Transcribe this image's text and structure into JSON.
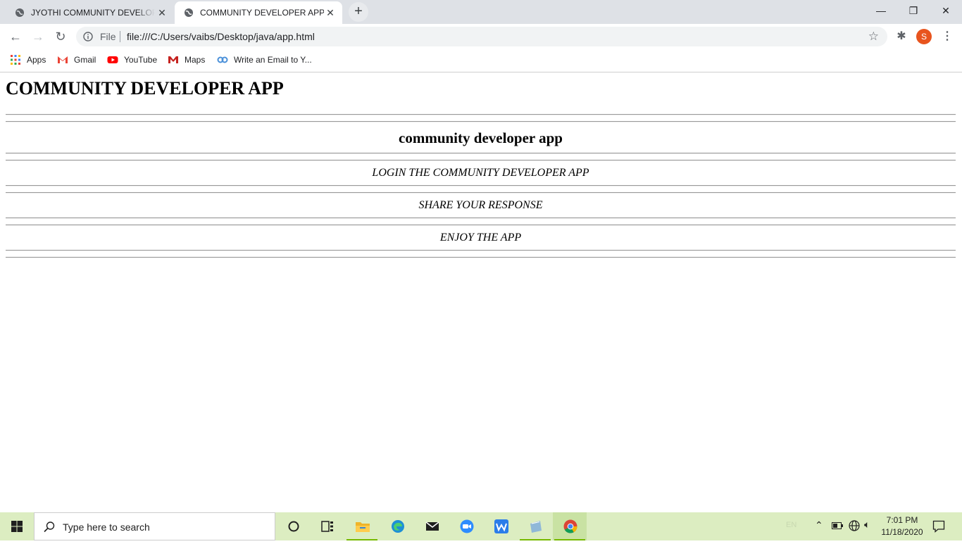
{
  "browser": {
    "tabs": [
      {
        "title": "JYOTHI COMMUNITY DEVELOPER",
        "active": false
      },
      {
        "title": "COMMUNITY DEVELOPER APP",
        "active": true
      }
    ],
    "address": {
      "scheme_label": "File",
      "url": "file:///C:/Users/vaibs/Desktop/java/app.html"
    },
    "profile_initial": "S",
    "bookmarks": [
      {
        "label": "Apps",
        "icon": "apps-grid-icon"
      },
      {
        "label": "Gmail",
        "icon": "gmail-icon"
      },
      {
        "label": "YouTube",
        "icon": "youtube-icon"
      },
      {
        "label": "Maps",
        "icon": "maps-icon"
      },
      {
        "label": "Write an Email to Y...",
        "icon": "link-icon"
      }
    ]
  },
  "page": {
    "heading": "COMMUNITY DEVELOPER APP",
    "subheading": "community developer app",
    "items": [
      "LOGIN THE COMMUNITY DEVELOPER APP",
      "SHARE YOUR RESPONSE",
      "ENJOY THE APP"
    ]
  },
  "taskbar": {
    "search_placeholder": "Type here to search",
    "time": "7:01 PM",
    "date": "11/18/2020",
    "lang": "EN",
    "accent_color": "#dcedc1"
  }
}
